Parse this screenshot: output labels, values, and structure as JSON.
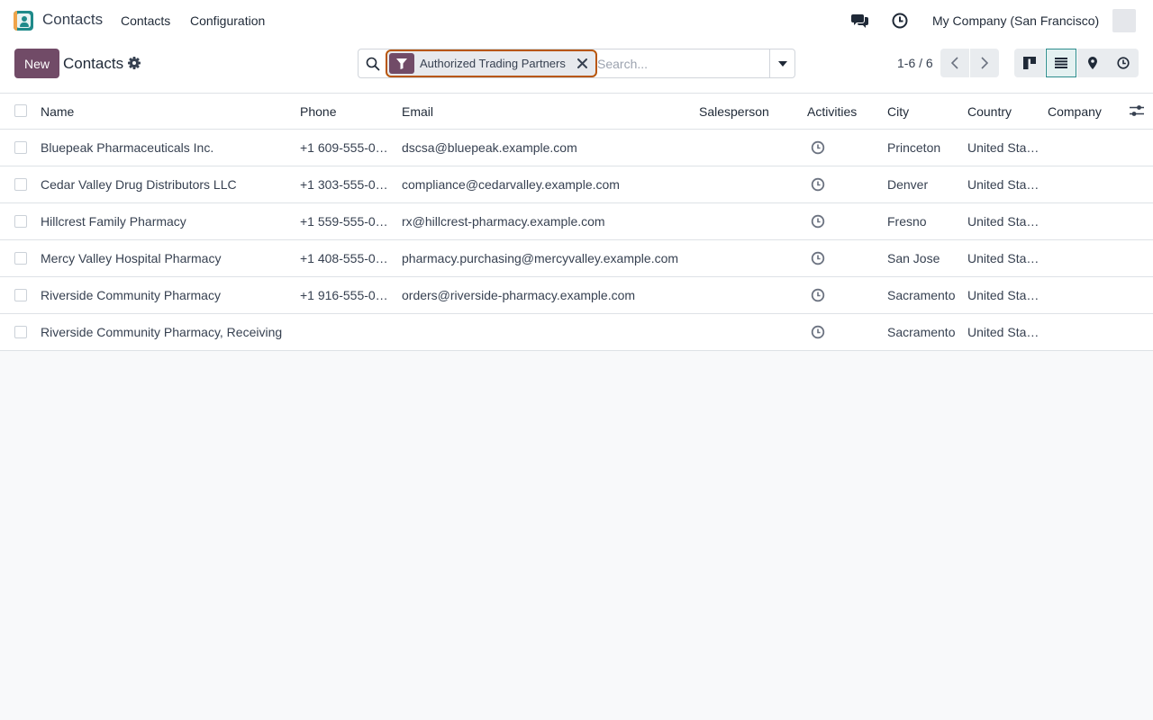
{
  "navbar": {
    "app_name": "Contacts",
    "menus": [
      "Contacts",
      "Configuration"
    ],
    "company": "My Company (San Francisco)"
  },
  "control_panel": {
    "new_label": "New",
    "title": "Contacts",
    "search": {
      "facet_label": "Authorized Trading Partners",
      "placeholder": "Search..."
    },
    "pager": "1-6 / 6"
  },
  "list": {
    "columns": [
      "Name",
      "Phone",
      "Email",
      "Salesperson",
      "Activities",
      "City",
      "Country",
      "Company"
    ],
    "rows": [
      {
        "name": "Bluepeak Pharmaceuticals Inc.",
        "phone": "+1 609-555-0…",
        "email": "dscsa@bluepeak.example.com",
        "city": "Princeton",
        "country": "United Sta…"
      },
      {
        "name": "Cedar Valley Drug Distributors LLC",
        "phone": "+1 303-555-0…",
        "email": "compliance@cedarvalley.example.com",
        "city": "Denver",
        "country": "United Sta…"
      },
      {
        "name": "Hillcrest Family Pharmacy",
        "phone": "+1 559-555-0…",
        "email": "rx@hillcrest-pharmacy.example.com",
        "city": "Fresno",
        "country": "United Sta…"
      },
      {
        "name": "Mercy Valley Hospital Pharmacy",
        "phone": "+1 408-555-0…",
        "email": "pharmacy.purchasing@mercyvalley.example.com",
        "city": "San Jose",
        "country": "United Sta…"
      },
      {
        "name": "Riverside Community Pharmacy",
        "phone": "+1 916-555-0…",
        "email": "orders@riverside-pharmacy.example.com",
        "city": "Sacramento",
        "country": "United Sta…"
      },
      {
        "name": "Riverside Community Pharmacy, Receiving",
        "phone": "",
        "email": "",
        "city": "Sacramento",
        "country": "United Sta…"
      }
    ]
  },
  "colors": {
    "brand": "#714b67",
    "accent": "#2c8c8c",
    "facet_border": "#b8560b"
  },
  "icons": {
    "messages": "chat-bubbles-icon",
    "activity": "clock-icon",
    "settings": "gear-icon",
    "search": "search-icon",
    "filter": "funnel-icon",
    "views": [
      "kanban-icon",
      "list-icon",
      "map-pin-icon",
      "clock-icon"
    ]
  }
}
